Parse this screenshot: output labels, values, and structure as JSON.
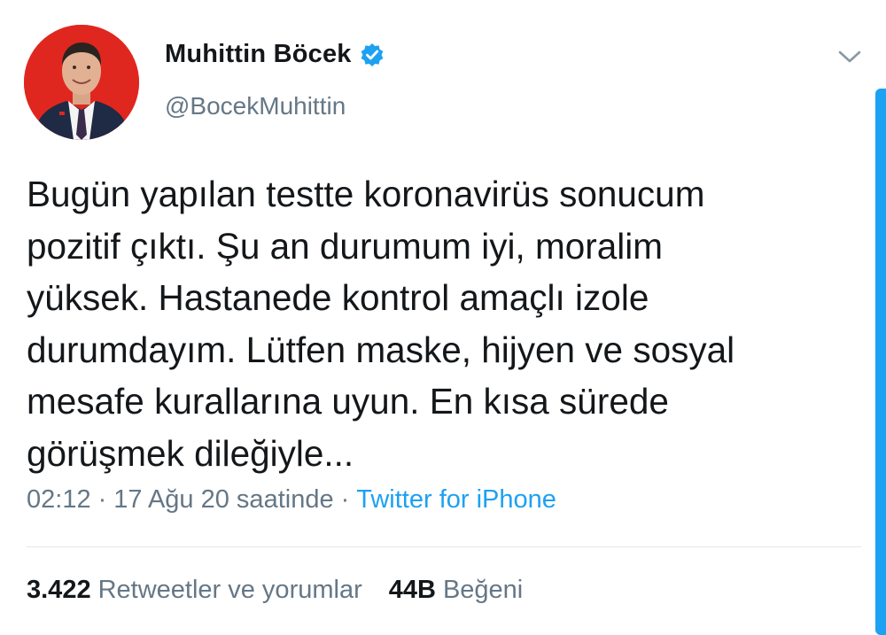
{
  "author": {
    "display_name": "Muhittin Böcek",
    "handle": "@BocekMuhittin",
    "verified": true,
    "avatar_icon": "profile-photo",
    "verified_icon": "verified-badge-icon"
  },
  "tweet": {
    "text": "Bugün yapılan testte koronavirüs sonucum\npozitif çıktı. Şu an durumum iyi, moralim\nyüksek. Hastanede kontrol amaçlı izole\ndurumdayım. Lütfen maske, hijyen ve sosyal\nmesafe kurallarına uyun. En kısa sürede\ngörüşmek dileğiyle..."
  },
  "meta": {
    "time": "02:12",
    "separator": "·",
    "date": "17 Ağu 20 saatinde",
    "source": "Twitter for iPhone"
  },
  "stats": {
    "retweets_count": "3.422",
    "retweets_label": "Retweetler ve yorumlar",
    "likes_count": "44B",
    "likes_label": "Beğeni"
  },
  "colors": {
    "accent": "#1da1f2",
    "text_primary": "#14171a",
    "text_secondary": "#657786",
    "avatar_background": "#e0271f"
  }
}
